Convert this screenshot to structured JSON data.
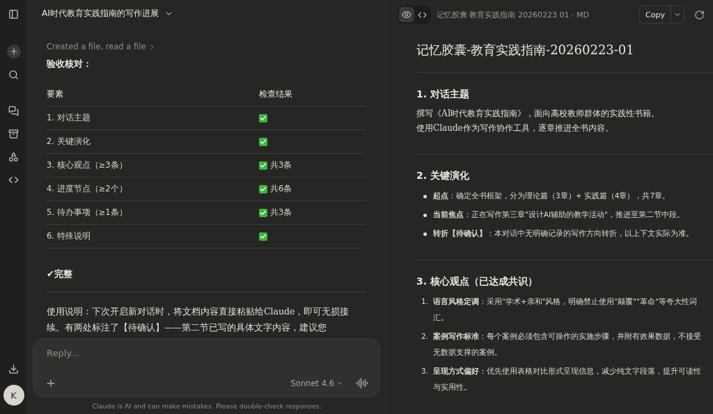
{
  "chat": {
    "title": "AI时代教育实践指南的写作进展",
    "tool_summary": "Created a file, read a file",
    "heading": "验收核对：",
    "table": {
      "columns": [
        "要素",
        "检查结果"
      ],
      "rows": [
        {
          "item": "1. 对话主题",
          "passed": true,
          "note": ""
        },
        {
          "item": "2. 关键演化",
          "passed": true,
          "note": ""
        },
        {
          "item": "3. 核心观点（≥3条）",
          "passed": true,
          "note": "共3条"
        },
        {
          "item": "4. 进度节点（≥2个）",
          "passed": true,
          "note": "共6条"
        },
        {
          "item": "5. 待办事项（≥1条）",
          "passed": true,
          "note": "共3条"
        },
        {
          "item": "6. 特殊说明",
          "passed": true,
          "note": ""
        }
      ]
    },
    "verdict": "✔完整",
    "paragraph": "使用说明：下次开启新对话时，将文档内容直接粘贴给Claude，即可无损接续。有两处标注了【待确认】——第二节已写的具体文字内容，建议您",
    "composer": {
      "placeholder": "Reply...",
      "model": "Sonnet 4.6"
    },
    "disclaimer": "Claude is AI and can make mistakes. Please double-check responses."
  },
  "sidebar": {
    "avatar": "K"
  },
  "artifact": {
    "view_tabs": [
      {
        "kind": "preview",
        "selected": true
      },
      {
        "kind": "code",
        "selected": false
      }
    ],
    "filename": "记忆胶囊 教育实践指南 20260223 01 · MD",
    "copy_label": "Copy",
    "title": "记忆胶囊-教育实践指南-20260223-01",
    "sections": [
      {
        "heading": "1. 对话主题",
        "kind": "paragraph",
        "lines": [
          "撰写《AI时代教育实践指南》，面向高校教师群体的实践性书籍。",
          "使用Claude作为写作协作工具，逐章推进全书内容。"
        ]
      },
      {
        "heading": "2. 关键演化",
        "kind": "bullets",
        "lines": [
          "**起点**：确定全书框架，分为理论篇（3章）+ 实践篇（4章），共7章。",
          "**当前焦点**：正在写作第三章\"设计AI辅助的教学活动\"，推进至第二节中段。",
          "**转折【待确认】**：本对话中无明确记录的写作方向转折，以上下文实际为准。"
        ]
      },
      {
        "heading": "3. 核心观点（已达成共识）",
        "kind": "numbered",
        "lines": [
          "**语言风格定调**：采用\"学术+亲和\"风格，明确禁止使用\"颠覆\"\"革命\"等夸大性词汇。",
          "**案例写作标准**：每个案例必须包含可操作的实施步骤，并附有效果数据，不接受无数据支撑的案例。",
          "**呈现方式偏好**：优先使用表格对比形式呈现信息，减少纯文字段落，提升可读性与实用性。"
        ],
        "numbers": [
          "1.",
          "2.",
          "3."
        ]
      }
    ]
  }
}
